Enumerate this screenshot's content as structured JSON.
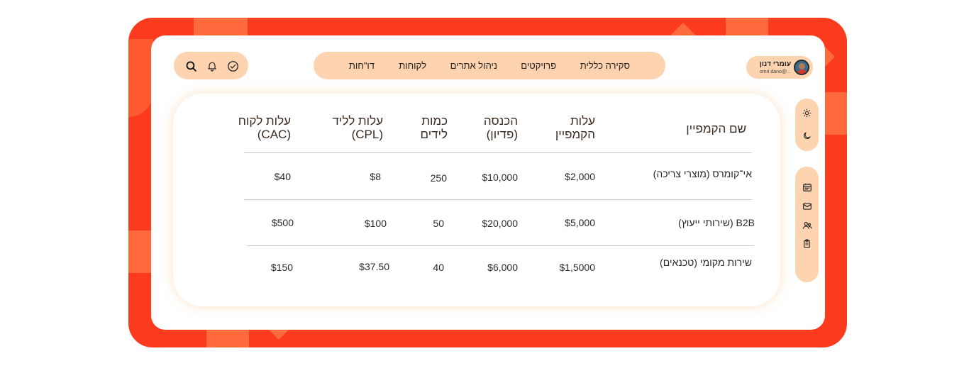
{
  "user": {
    "name": "עומרי דנון",
    "email": "omri.dano@..."
  },
  "nav": {
    "items": [
      {
        "label": "סקירה כללית"
      },
      {
        "label": "פרויקטים"
      },
      {
        "label": "ניהול אתרים"
      },
      {
        "label": "לקוחות"
      },
      {
        "label": "דו\"חות"
      }
    ]
  },
  "toolbar": {
    "icons": [
      "check-circle-icon",
      "bell-icon",
      "search-icon"
    ]
  },
  "theme": {
    "icons": [
      "sun-icon",
      "moon-icon"
    ]
  },
  "sidebar": {
    "icons": [
      "calendar-icon",
      "mail-icon",
      "users-icon",
      "clipboard-icon"
    ]
  },
  "table": {
    "headers": [
      {
        "lines": [
          "שם הקמפיין"
        ]
      },
      {
        "lines": [
          "עלות",
          "הקמפיין"
        ]
      },
      {
        "lines": [
          "הכנסה",
          "(פדיון)"
        ]
      },
      {
        "lines": [
          "כמות",
          "לידים"
        ]
      },
      {
        "lines": [
          "עלות לליד",
          "(CPL)"
        ]
      },
      {
        "lines": [
          "עלות לקוח",
          "(CAC)"
        ]
      }
    ],
    "rows": [
      {
        "name": "אי־קומרס (מוצרי צריכה)",
        "cost": "$2,000",
        "revenue": "$10,000",
        "leads": "250",
        "cpl": "$8",
        "cac": "$40"
      },
      {
        "name": "B2B (שירותי ייעוץ)",
        "cost": "$5,000",
        "revenue": "$20,000",
        "leads": "50",
        "cpl": "$100",
        "cac": "$500"
      },
      {
        "name": "שירות מקומי (טכנאים)",
        "cost": "$1,5000",
        "revenue": "$6,000",
        "leads": "40",
        "cpl": "$37.50",
        "cac": "$150"
      }
    ]
  },
  "colors": {
    "frame": "#fb3a1e",
    "pill": "#fdd3b0",
    "accent": "#ff6a3d"
  }
}
